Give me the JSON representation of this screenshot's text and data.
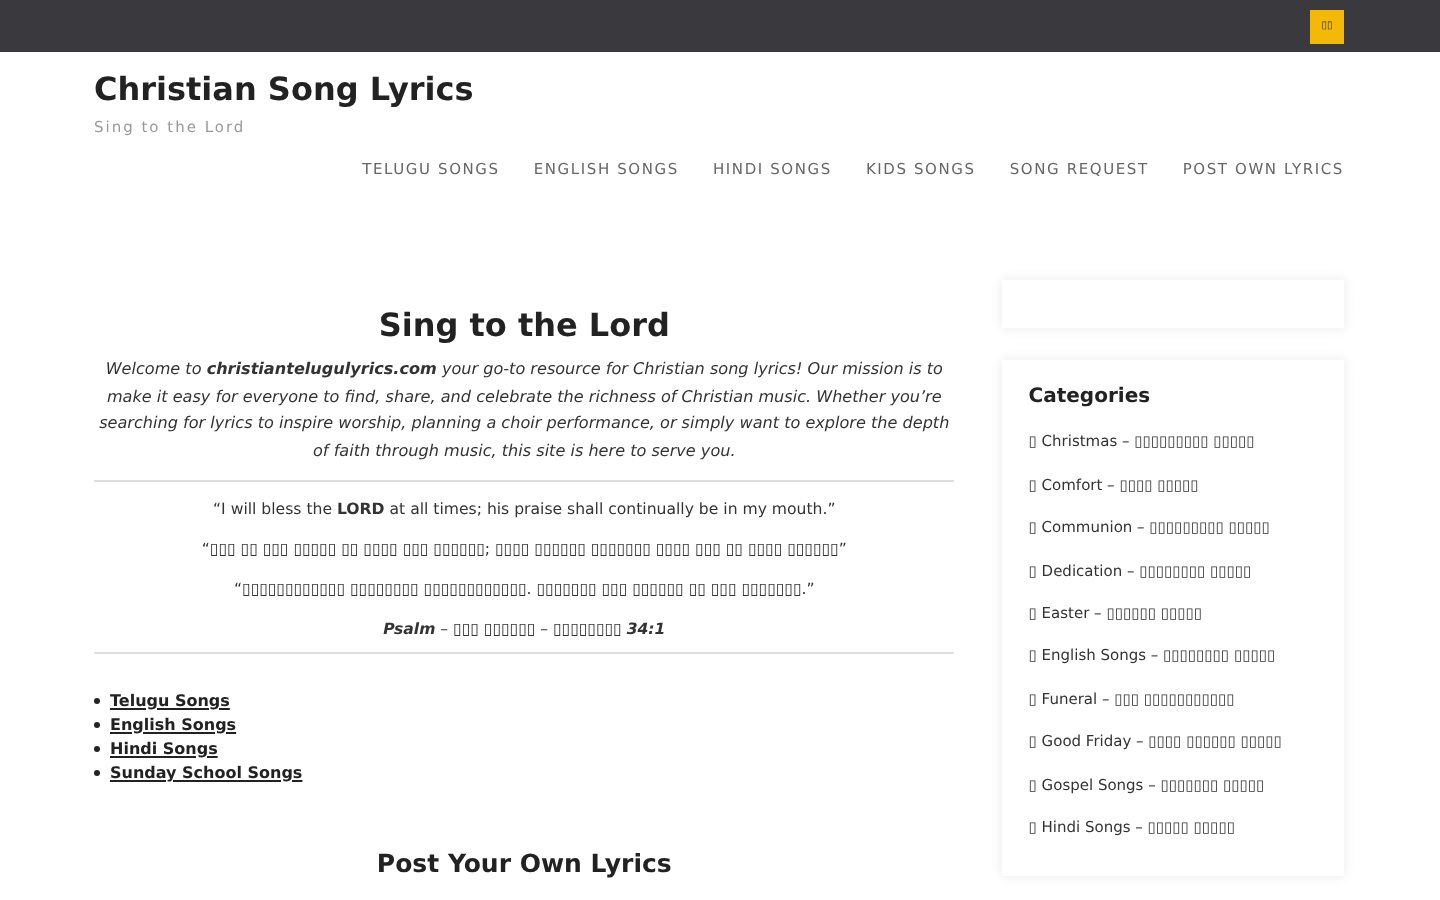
{
  "top_bar": {
    "button": "▯▯"
  },
  "site": {
    "title": "Christian Song Lyrics",
    "tagline": "Sing to the Lord"
  },
  "nav": [
    "TELUGU SONGS",
    "ENGLISH SONGS",
    "HINDI SONGS",
    "KIDS SONGS",
    "SONG REQUEST",
    "POST OWN LYRICS"
  ],
  "main": {
    "heading": "Sing to the Lord",
    "intro": "Welcome to **christiantelugulyrics.com** your go-to resource for Christian song lyrics! Our mission is to make it easy for everyone to find, share, and celebrate the richness of Christian music. Whether you’re searching for lyrics to inspire worship, planning a choir performance, or simply want to explore the depth of faith through music, this site is here to serve you.",
    "verses": [
      "“I will bless the **LORD** at all times; his praise shall continually be in my mouth.”",
      "“▯▯▯ ▯▯ ▯▯▯ ▯▯▯▯▯ ▯▯ ▯▯▯▯ ▯▯▯ ▯▯▯▯▯▯; ▯▯▯▯ ▯▯▯▯▯▯ ▯▯▯▯▯▯▯ ▯▯▯▯ ▯▯▯ ▯▯ ▯▯▯▯ ▯▯▯▯▯▯”",
      "“▯▯▯▯▯▯▯▯▯▯▯▯ ▯▯▯▯▯▯▯▯ ▯▯▯▯▯▯▯▯▯▯▯▯. ▯▯▯▯▯▯▯ ▯▯▯ ▯▯▯▯▯▯ ▯▯ ▯▯▯ ▯▯▯▯▯▯▯.”"
    ],
    "reference": "**Psalm** – ▯▯▯ ▯▯▯▯▯▯ – ▯▯▯▯▯▯▯▯ **34:1**",
    "links": [
      "Telugu Songs",
      "English Songs",
      "Hindi Songs",
      "Sunday School Songs"
    ],
    "section_heading": "Post Your Own Lyrics"
  },
  "sidebar": {
    "categories_title": "Categories",
    "categories": [
      "▯ Christmas – ▯▯▯▯▯▯▯▯▯ ▯▯▯▯▯",
      "▯ Comfort – ▯▯▯▯ ▯▯▯▯▯",
      "▯ Communion – ▯▯▯▯▯▯▯▯▯ ▯▯▯▯▯",
      "▯ Dedication – ▯▯▯▯▯▯▯▯ ▯▯▯▯▯",
      "▯ Easter – ▯▯▯▯▯▯ ▯▯▯▯▯",
      "▯ English Songs – ▯▯▯▯▯▯▯▯ ▯▯▯▯▯",
      "▯ Funeral – ▯▯▯ ▯▯▯▯▯▯▯▯▯▯▯",
      "▯ Good Friday – ▯▯▯▯ ▯▯▯▯▯▯ ▯▯▯▯▯",
      "▯ Gospel Songs – ▯▯▯▯▯▯▯ ▯▯▯▯▯",
      "▯ Hindi Songs – ▯▯▯▯▯ ▯▯▯▯▯"
    ]
  }
}
